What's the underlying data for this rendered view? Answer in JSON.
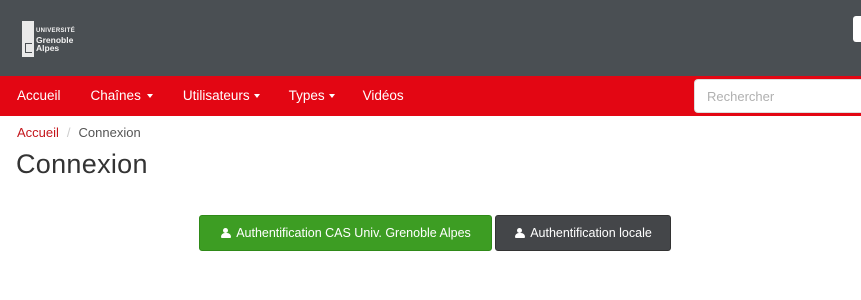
{
  "header": {
    "logo": {
      "line1": "UNIVERSITÉ",
      "line2": "Grenoble",
      "line3": "Alpes"
    }
  },
  "nav": {
    "items": [
      {
        "label": "Accueil",
        "dropdown": false
      },
      {
        "label": "Chaînes",
        "dropdown": true
      },
      {
        "label": "Utilisateurs",
        "dropdown": true
      },
      {
        "label": "Types",
        "dropdown": true
      },
      {
        "label": "Vidéos",
        "dropdown": false
      }
    ],
    "search": {
      "placeholder": "Rechercher",
      "value": ""
    }
  },
  "breadcrumb": {
    "home": "Accueil",
    "separator": "/",
    "current": "Connexion"
  },
  "page": {
    "title": "Connexion"
  },
  "buttons": {
    "cas_label": "Authentification CAS Univ. Grenoble Alpes",
    "local_label": "Authentification locale",
    "icon": "user-icon"
  },
  "colors": {
    "header_bg": "#4a4f53",
    "nav_bg": "#e30613",
    "link": "#c4161c",
    "cas_button": "#3d9d23",
    "local_button": "#444649"
  }
}
